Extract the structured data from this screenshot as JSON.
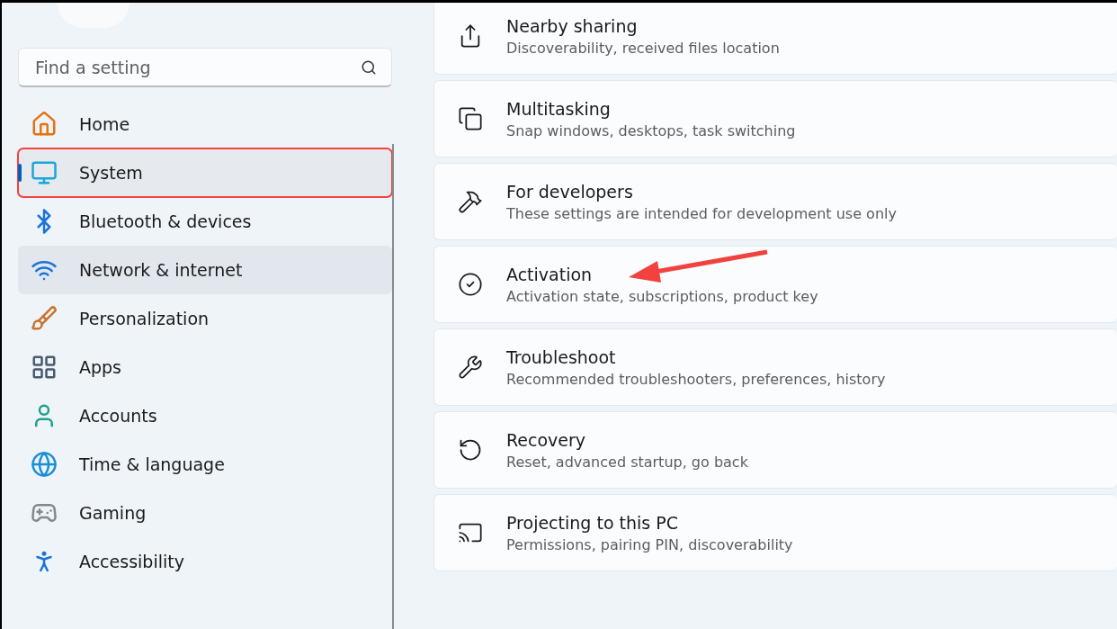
{
  "sidebar": {
    "search": {
      "placeholder": "Find a setting"
    },
    "items": [
      {
        "label": "Home",
        "selected": false,
        "hovered": false,
        "highlighted": false
      },
      {
        "label": "System",
        "selected": true,
        "hovered": false,
        "highlighted": true
      },
      {
        "label": "Bluetooth & devices",
        "selected": false,
        "hovered": false,
        "highlighted": false
      },
      {
        "label": "Network & internet",
        "selected": false,
        "hovered": true,
        "highlighted": false
      },
      {
        "label": "Personalization",
        "selected": false,
        "hovered": false,
        "highlighted": false
      },
      {
        "label": "Apps",
        "selected": false,
        "hovered": false,
        "highlighted": false
      },
      {
        "label": "Accounts",
        "selected": false,
        "hovered": false,
        "highlighted": false
      },
      {
        "label": "Time & language",
        "selected": false,
        "hovered": false,
        "highlighted": false
      },
      {
        "label": "Gaming",
        "selected": false,
        "hovered": false,
        "highlighted": false
      },
      {
        "label": "Accessibility",
        "selected": false,
        "hovered": false,
        "highlighted": false
      }
    ]
  },
  "settings": [
    {
      "title": "Nearby sharing",
      "description": "Discoverability, received files location",
      "pointed": false
    },
    {
      "title": "Multitasking",
      "description": "Snap windows, desktops, task switching",
      "pointed": false
    },
    {
      "title": "For developers",
      "description": "These settings are intended for development use only",
      "pointed": false
    },
    {
      "title": "Activation",
      "description": "Activation state, subscriptions, product key",
      "pointed": true
    },
    {
      "title": "Troubleshoot",
      "description": "Recommended troubleshooters, preferences, history",
      "pointed": false
    },
    {
      "title": "Recovery",
      "description": "Reset, advanced startup, go back",
      "pointed": false
    },
    {
      "title": "Projecting to this PC",
      "description": "Permissions, pairing PIN, discoverability",
      "pointed": false
    }
  ]
}
